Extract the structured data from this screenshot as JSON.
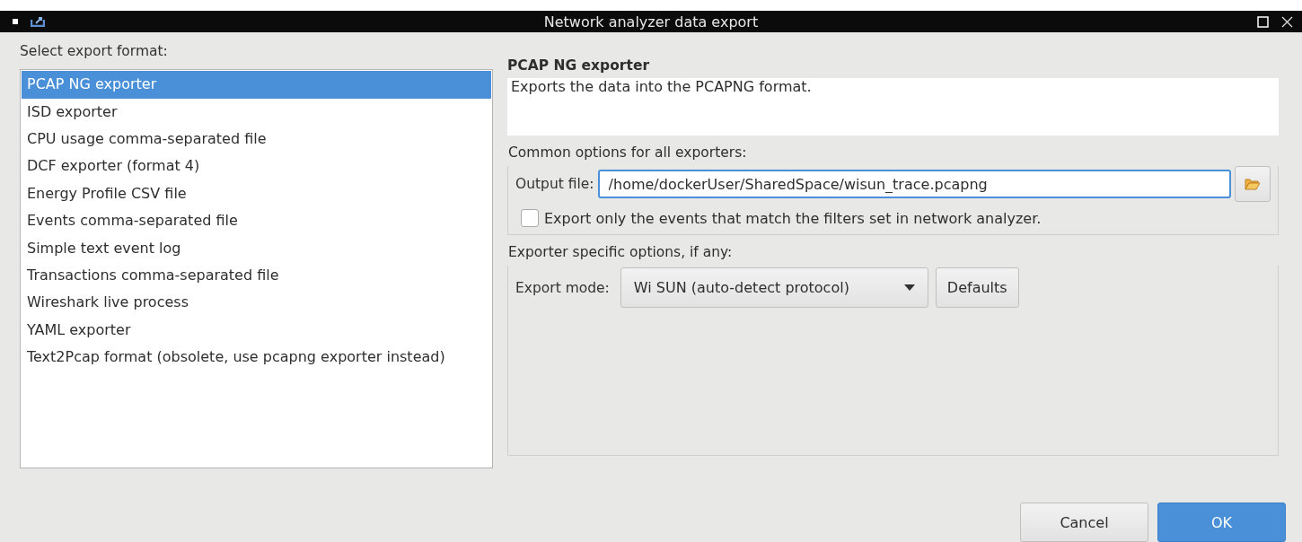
{
  "window": {
    "title": "Network analyzer data export"
  },
  "format_list": {
    "label": "Select export format:",
    "items": [
      {
        "label": "PCAP NG exporter",
        "selected": true
      },
      {
        "label": "ISD exporter",
        "selected": false
      },
      {
        "label": "CPU usage comma-separated file",
        "selected": false
      },
      {
        "label": "DCF exporter (format 4)",
        "selected": false
      },
      {
        "label": "Energy Profile CSV file",
        "selected": false
      },
      {
        "label": "Events comma-separated file",
        "selected": false
      },
      {
        "label": "Simple text event log",
        "selected": false
      },
      {
        "label": "Transactions comma-separated file",
        "selected": false
      },
      {
        "label": "Wireshark live process",
        "selected": false
      },
      {
        "label": "YAML exporter",
        "selected": false
      },
      {
        "label": "Text2Pcap format (obsolete, use pcapng exporter instead)",
        "selected": false
      }
    ]
  },
  "exporter": {
    "title": "PCAP NG exporter",
    "description": "Exports the data into the PCAPNG format."
  },
  "common_options": {
    "title": "Common options for all exporters:",
    "output_label": "Output file:",
    "output_value": "/home/dockerUser/SharedSpace/wisun_trace.pcapng",
    "filter_checkbox": {
      "label": "Export only the events that match the filters set in network analyzer.",
      "checked": false
    }
  },
  "specific_options": {
    "title": "Exporter specific options, if any:",
    "mode_label": "Export mode:",
    "mode_value": "Wi SUN (auto-detect protocol)",
    "defaults_button": "Defaults"
  },
  "buttons": [
    {
      "label": "Cancel",
      "kind": "secondary"
    },
    {
      "label": "OK",
      "kind": "primary"
    }
  ]
}
